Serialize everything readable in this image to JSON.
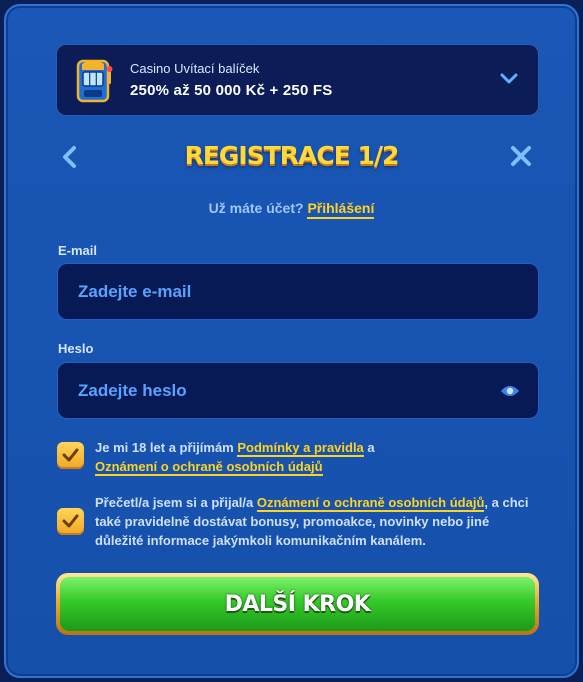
{
  "promo": {
    "title": "Casino Uvítací balíček",
    "amount": "250% až 50 000 Kč + 250 FS",
    "icon": "slot-machine-icon"
  },
  "header": {
    "title": "REGISTRACE 1/2",
    "back_icon": "chevron-left-icon",
    "close_icon": "close-icon"
  },
  "account": {
    "question": "Už máte účet?",
    "login_label": "Přihlášení"
  },
  "email": {
    "label": "E-mail",
    "placeholder": "Zadejte e-mail",
    "value": ""
  },
  "password": {
    "label": "Heslo",
    "placeholder": "Zadejte heslo",
    "value": ""
  },
  "consents": [
    {
      "checked": true,
      "text_before": "Je mi 18 let a přijímám ",
      "link1": "Podmínky a pravidla",
      "text_between": " a ",
      "link2": "Oznámení o ochraně osobních údajů"
    },
    {
      "checked": true,
      "text_before": "Přečetl/a jsem si a přijal/a ",
      "link1": "Oznámení o ochraně osobních údajů",
      "text_after": ", a chci také pravidelně dostávat bonusy, promoakce, novinky nebo jiné důležité informace jakýmkoli komunikačním kanálem."
    }
  ],
  "cta": {
    "label": "DALŠÍ KROK"
  },
  "colors": {
    "accent_yellow": "#ffd21f",
    "title_yellow": "#ffd83a",
    "cta_green": "#35c92a",
    "panel_blue": "#1a57b6",
    "field_bg": "#081a55",
    "placeholder_blue": "#5aa2ff"
  }
}
